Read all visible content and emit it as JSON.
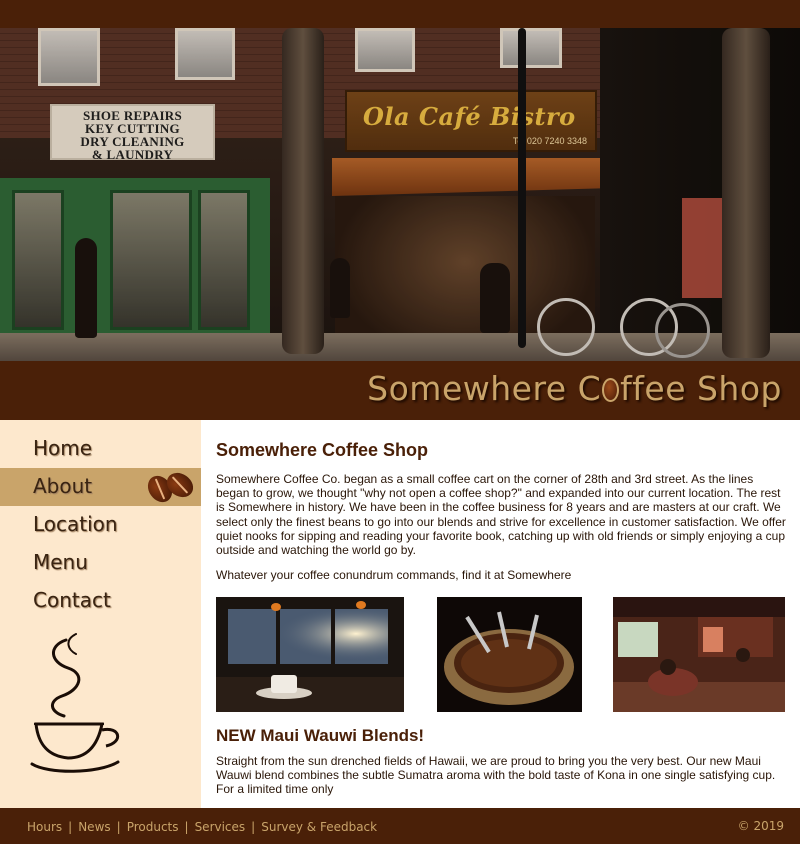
{
  "hero": {
    "shop_sign_lines": [
      "SHOE REPAIRS",
      "KEY CUTTING",
      "DRY CLEANING",
      "& LAUNDRY"
    ],
    "cafe_sign": "Ola Café Bistro",
    "cafe_tel": "Tel 020 7240 3348"
  },
  "site": {
    "title_before": "Somewhere C",
    "title_after": "ffee Shop"
  },
  "nav": {
    "items": [
      {
        "label": "Home"
      },
      {
        "label": "About"
      },
      {
        "label": "Location"
      },
      {
        "label": "Menu"
      },
      {
        "label": "Contact"
      }
    ],
    "active": "About"
  },
  "main": {
    "heading": "Somewhere Coffee Shop",
    "intro": "Somewhere Coffee Co. began as a small coffee cart on the corner of 28th and 3rd street. As the lines began to grow, we thought \"why not open a coffee shop?\" and expanded into our current location. The rest is Somewhere in history. We have been in the coffee business for 8 years and are masters at our craft. We select only the finest beans to go into our blends and strive for excellence in customer satisfaction. We offer quiet nooks for sipping and reading your favorite book, catching up with old friends or simply enjoying a cup outside and watching the world go by.",
    "tagline": "Whatever your coffee conundrum commands, find it at Somewhere",
    "subheading": "NEW Maui Wauwi Blends!",
    "blend_text": "Straight from the sun drenched fields of Hawaii, we are proud to bring you the very best. Our new Maui Wauwi blend combines the subtle Sumatra aroma with the bold taste of Kona in one single satisfying cup. For a limited time only"
  },
  "footer": {
    "links": [
      "Hours",
      "News",
      "Products",
      "Services",
      "Survey & Feedback"
    ],
    "separator": "|",
    "copyright": "© 2019"
  },
  "colors": {
    "dark_brown": "#4a2008",
    "gold": "#c9a46a",
    "sidebar_bg": "#fde8cd",
    "active_nav": "#c9a46a"
  }
}
